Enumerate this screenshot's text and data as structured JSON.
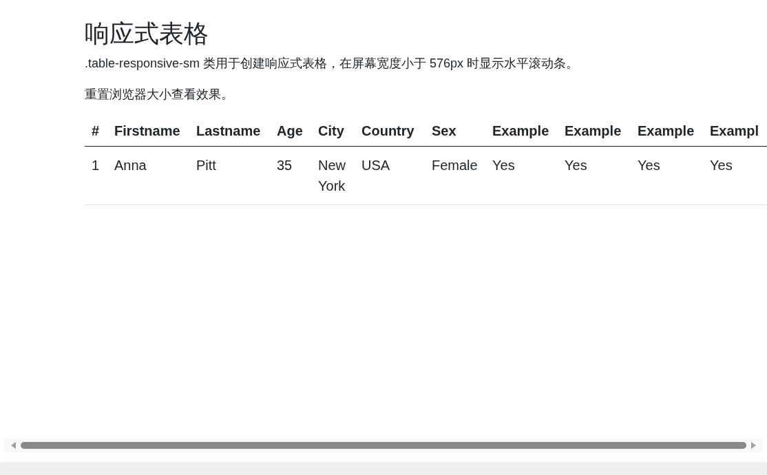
{
  "title": "响应式表格",
  "description": ".table-responsive-sm 类用于创建响应式表格，在屏幕宽度小于 576px 时显示水平滚动条。",
  "note": "重置浏览器大小查看效果。",
  "table": {
    "columns": [
      "#",
      "Firstname",
      "Lastname",
      "Age",
      "City",
      "Country",
      "Sex",
      "Example",
      "Example",
      "Example",
      "Exampl"
    ],
    "rows": [
      [
        "1",
        "Anna",
        "Pitt",
        "35",
        "New York",
        "USA",
        "Female",
        "Yes",
        "Yes",
        "Yes",
        "Yes"
      ]
    ]
  }
}
